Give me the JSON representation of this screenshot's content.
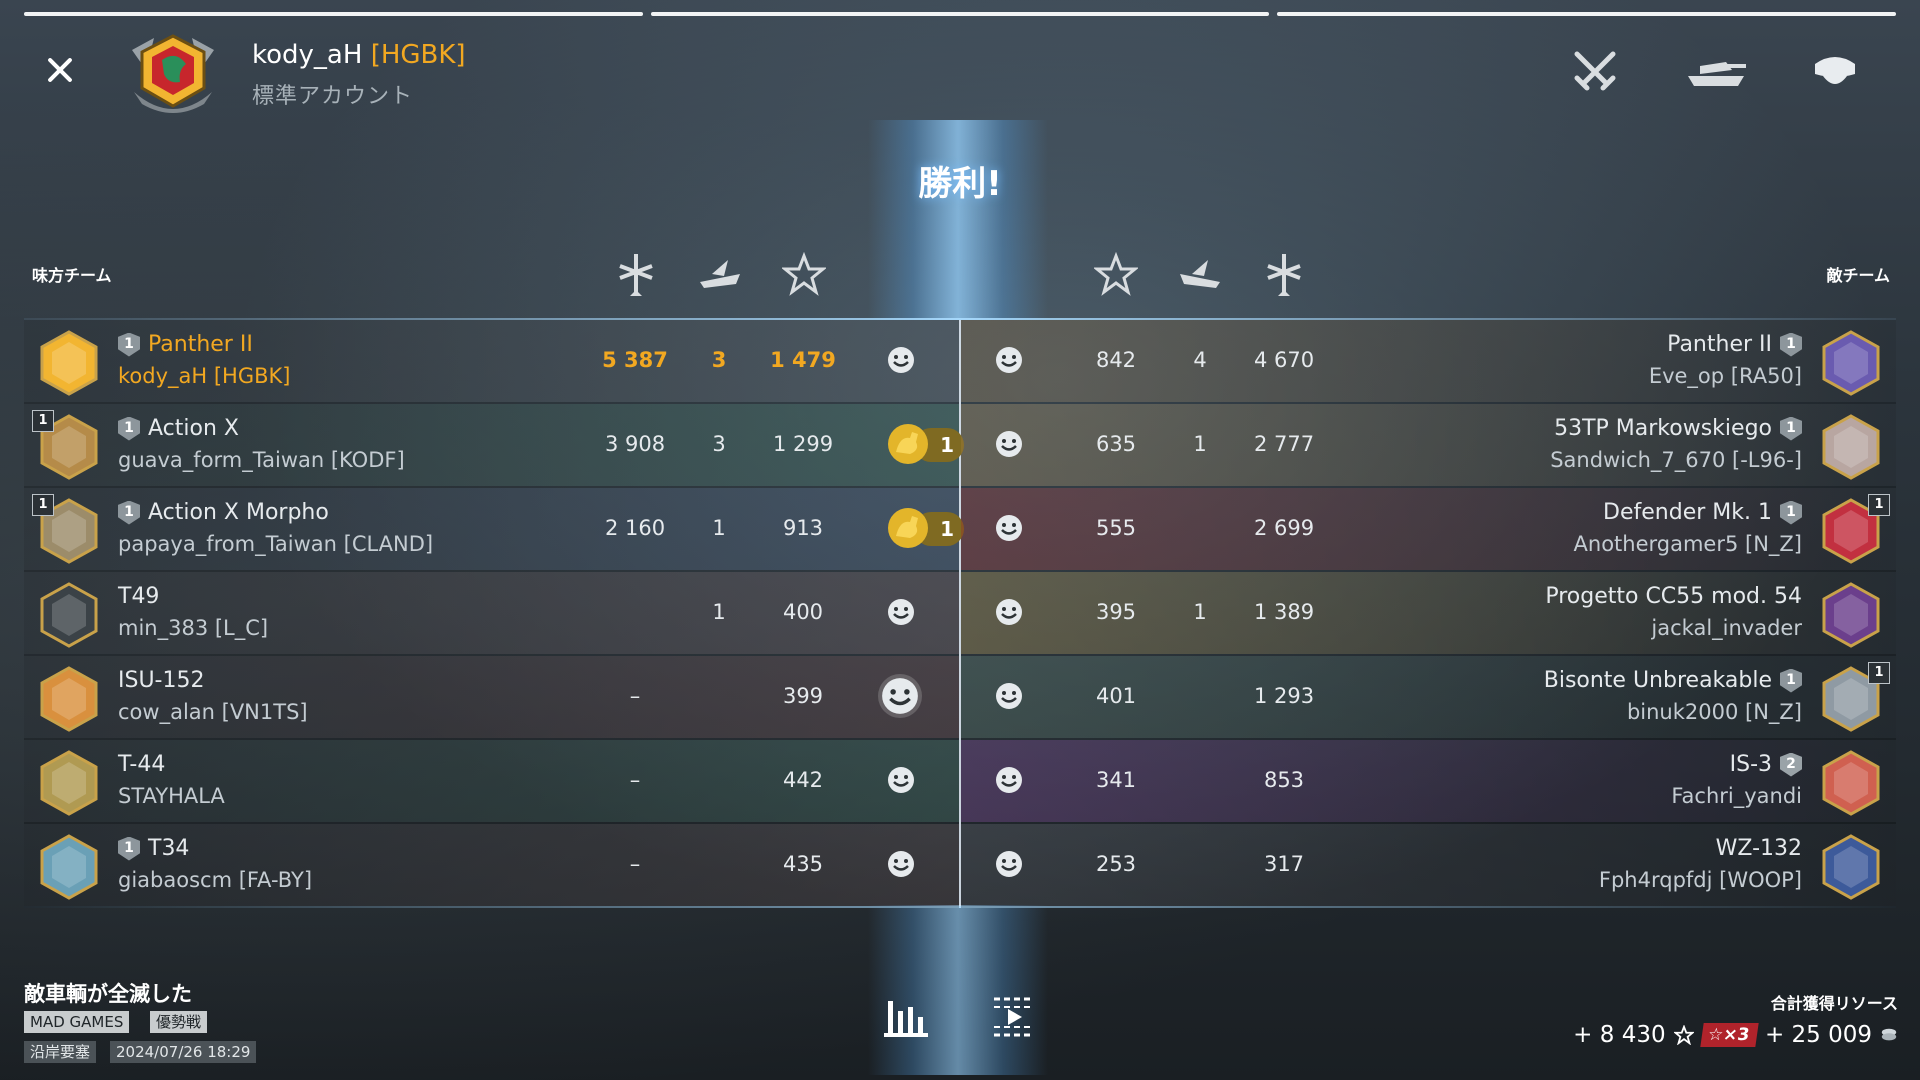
{
  "header": {
    "player": "kody_aH",
    "clan": "[HGBK]",
    "account_type": "標準アカウント",
    "icons": [
      "crossed-swords-icon",
      "tank-icon",
      "team-helmet-icon"
    ]
  },
  "result_title": "勝利!",
  "teams": {
    "ally_label": "味方チーム",
    "enemy_label": "敵チーム"
  },
  "columns": {
    "icons": [
      "damage-icon",
      "kills-icon",
      "xp-star-icon"
    ]
  },
  "ally": [
    {
      "tank": "Panther II",
      "mastery": "1",
      "player": "kody_aH [HGBK]",
      "damage": "5 387",
      "kills": "3",
      "xp": "1 479",
      "me": true,
      "rank_badge": "",
      "reward": ""
    },
    {
      "tank": "Action X",
      "mastery": "1",
      "player": "guava_form_Taiwan [KODF]",
      "damage": "3 908",
      "kills": "3",
      "xp": "1 299",
      "me": false,
      "rank_badge": "1",
      "reward": "1"
    },
    {
      "tank": "Action X Morpho",
      "mastery": "1",
      "player": "papaya_from_Taiwan [CLAND]",
      "damage": "2 160",
      "kills": "1",
      "xp": "913",
      "me": false,
      "rank_badge": "1",
      "reward": "1"
    },
    {
      "tank": "T49",
      "mastery": "",
      "player": "min_383 [L_C]",
      "damage": "",
      "kills": "1",
      "xp": "400",
      "me": false,
      "rank_badge": "",
      "reward": ""
    },
    {
      "tank": "ISU-152",
      "mastery": "",
      "player": "cow_alan [VN1TS]",
      "damage": "–",
      "kills": "",
      "xp": "399",
      "me": false,
      "rank_badge": "",
      "reward": ""
    },
    {
      "tank": "T-44",
      "mastery": "",
      "player": "STAYHALA",
      "damage": "–",
      "kills": "",
      "xp": "442",
      "me": false,
      "rank_badge": "",
      "reward": ""
    },
    {
      "tank": "T34",
      "mastery": "1",
      "player": "giabaoscm [FA-BY]",
      "damage": "–",
      "kills": "",
      "xp": "435",
      "me": false,
      "rank_badge": "",
      "reward": ""
    }
  ],
  "enemy": [
    {
      "tank": "Panther II",
      "mastery": "1",
      "player": "Eve_op [RA50]",
      "xp": "842",
      "kills": "4",
      "damage": "4 670",
      "rank_badge": ""
    },
    {
      "tank": "53TP Markowskiego",
      "mastery": "1",
      "player": "Sandwich_7_670 [-L96-]",
      "xp": "635",
      "kills": "1",
      "damage": "2 777",
      "rank_badge": ""
    },
    {
      "tank": "Defender Mk. 1",
      "mastery": "1",
      "player": "Anothergamer5 [N_Z]",
      "xp": "555",
      "kills": "",
      "damage": "2 699",
      "rank_badge": "1"
    },
    {
      "tank": "Progetto CC55 mod. 54",
      "mastery": "",
      "player": "jackal_invader",
      "xp": "395",
      "kills": "1",
      "damage": "1 389",
      "rank_badge": ""
    },
    {
      "tank": "Bisonte Unbreakable",
      "mastery": "1",
      "player": "binuk2000 [N_Z]",
      "xp": "401",
      "kills": "",
      "damage": "1 293",
      "rank_badge": "1"
    },
    {
      "tank": "IS-3",
      "mastery": "2",
      "player": "Fachri_yandi",
      "xp": "341",
      "kills": "",
      "damage": "853",
      "rank_badge": ""
    },
    {
      "tank": "WZ-132",
      "mastery": "",
      "player": "Fph4rqpfdj [WOOP]",
      "xp": "253",
      "kills": "",
      "damage": "317",
      "rank_badge": ""
    }
  ],
  "footer": {
    "reason": "敵車輌が全滅した",
    "tags": [
      "MAD GAMES",
      "優勢戦"
    ],
    "map": "沿岸要塞",
    "datetime": "2024/07/26 18:29",
    "resources_title": "合計獲得リソース",
    "xp_gain": "+ 8 430",
    "multiplier": "×3",
    "credits_gain": "+ 25 009"
  },
  "colors": {
    "accent": "#f2a821",
    "victory_glow": "#7fc0ff",
    "multiplier_bg": "#b0232b"
  }
}
